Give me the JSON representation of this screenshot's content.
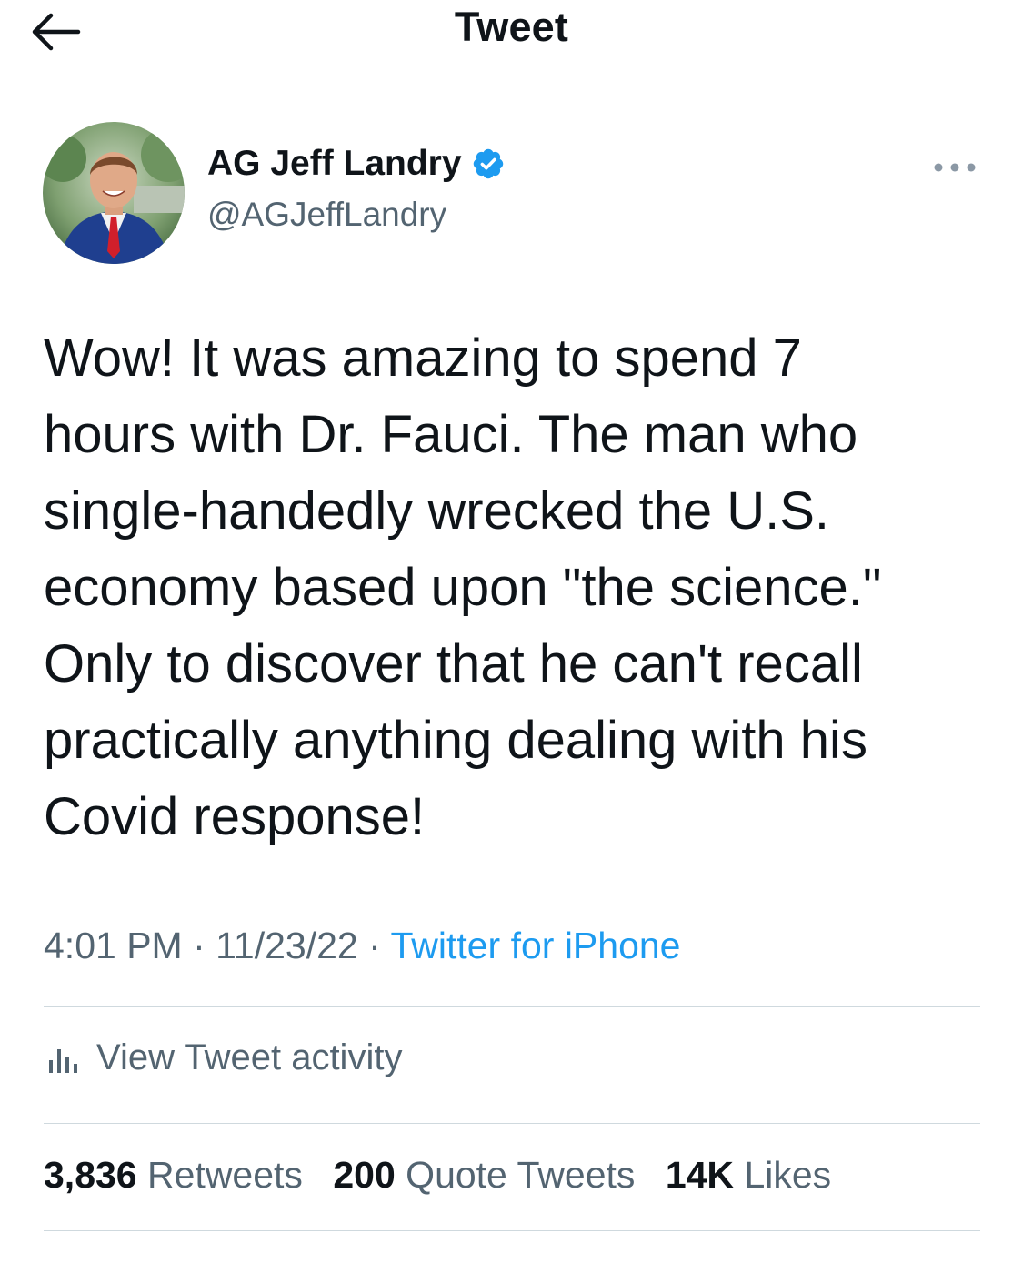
{
  "header": {
    "title": "Tweet",
    "back_icon": "arrow-left-icon"
  },
  "author": {
    "display_name": "AG Jeff Landry",
    "handle": "@AGJeffLandry",
    "verified_icon": "verified-badge-icon",
    "verified_color": "#1d9bf0"
  },
  "tweet": {
    "text": "Wow! It was amazing to spend 7\nhours with Dr. Fauci. The man who\nsingle-handedly wrecked the U.S.\neconomy based upon \"the science.\"\nOnly to discover that he can't recall\npractically anything dealing with his\nCovid response!",
    "time": "4:01 PM",
    "separator": "·",
    "date": "11/23/22",
    "source": "Twitter for iPhone"
  },
  "activity": {
    "label": "View Tweet activity",
    "icon": "bar-chart-icon"
  },
  "stats": {
    "retweets_count": "3,836",
    "retweets_label": "Retweets",
    "quotes_count": "200",
    "quotes_label": "Quote Tweets",
    "likes_count": "14K",
    "likes_label": "Likes"
  },
  "colors": {
    "text": "#0f1419",
    "secondary": "#536471",
    "link": "#1d9bf0",
    "divider": "#cfd9de"
  }
}
